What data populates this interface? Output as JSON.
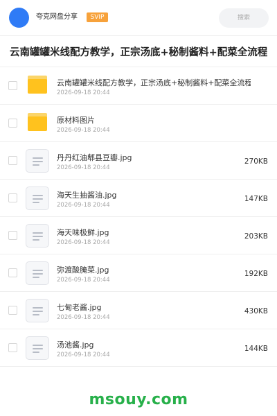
{
  "header": {
    "share_name": "夸克网盘分享",
    "badge": "SVIP",
    "search_placeholder": "搜索",
    "accent_color": "#2f7bf6",
    "badge_color": "#f7a23b"
  },
  "title": "云南罐罐米线配方教学，正宗汤底+秘制酱料+配菜全流程",
  "files": [
    {
      "type": "folder",
      "name": "云南罐罐米线配方教学，正宗汤底+秘制酱料+配菜全流程",
      "date": "2026-09-18 20:44",
      "size": ""
    },
    {
      "type": "folder",
      "name": "原材料图片",
      "date": "2026-09-18 20:44",
      "size": ""
    },
    {
      "type": "file",
      "name": "丹丹红油郫县豆瓣.jpg",
      "date": "2026-09-18 20:44",
      "size": "270KB"
    },
    {
      "type": "file",
      "name": "海天生抽酱油.jpg",
      "date": "2026-09-18 20:44",
      "size": "147KB"
    },
    {
      "type": "file",
      "name": "海天味极鲜.jpg",
      "date": "2026-09-18 20:44",
      "size": "203KB"
    },
    {
      "type": "file",
      "name": "弥渡酸腌菜.jpg",
      "date": "2026-09-18 20:44",
      "size": "192KB"
    },
    {
      "type": "file",
      "name": "七甸老酱.jpg",
      "date": "2026-09-18 20:44",
      "size": "430KB"
    },
    {
      "type": "file",
      "name": "汤池酱.jpg",
      "date": "2026-09-18 20:44",
      "size": "144KB"
    }
  ],
  "watermark": "msouy.com",
  "icons": {
    "folder": "folder-icon",
    "file": "image-file-icon",
    "checkbox": "checkbox-icon"
  }
}
